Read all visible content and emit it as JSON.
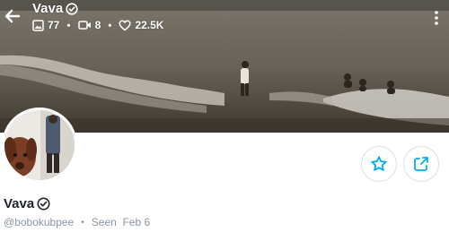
{
  "header": {
    "title": "Vava",
    "stats": {
      "photos": "77",
      "videos": "8",
      "likes": "22.5K"
    },
    "separator": "•"
  },
  "profile": {
    "name": "Vava",
    "username": "@bobokubpee",
    "separator": "•",
    "last_seen": "Seen  Feb 6"
  },
  "icons": {
    "back": "arrow-left-icon",
    "verified": "verified-badge-icon",
    "photos": "image-icon",
    "videos": "video-icon",
    "likes": "heart-icon",
    "more": "more-vertical-icon",
    "favorite": "star-icon",
    "share": "share-icon"
  },
  "colors": {
    "accent": "#00aff0",
    "text": "#1f2329",
    "muted": "#8a96a3"
  }
}
